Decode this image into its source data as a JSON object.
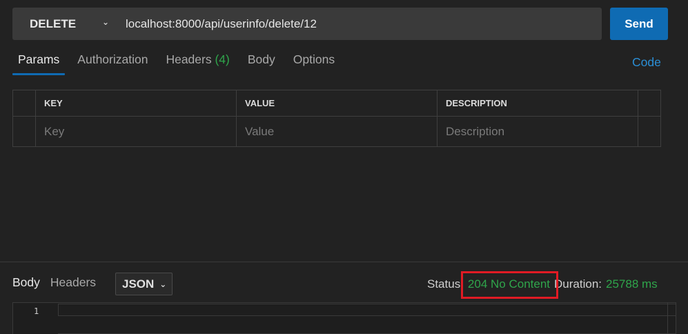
{
  "request": {
    "method": "DELETE",
    "url": "localhost:8000/api/userinfo/delete/12",
    "send_label": "Send"
  },
  "tabs": {
    "params": "Params",
    "authorization": "Authorization",
    "headers": "Headers",
    "headers_count": "(4)",
    "body": "Body",
    "options": "Options",
    "active": "Params"
  },
  "code_link": "Code",
  "params_table": {
    "columns": [
      "KEY",
      "VALUE",
      "DESCRIPTION"
    ],
    "placeholders": [
      "Key",
      "Value",
      "Description"
    ]
  },
  "response": {
    "tabs": [
      "Body",
      "Headers"
    ],
    "active_tab": "Body",
    "format": "JSON",
    "status_label": "Status:",
    "status_value": "204 No Content",
    "duration_label": "Duration:",
    "duration_value": "25788 ms"
  },
  "editor": {
    "line_number": "1"
  },
  "colors": {
    "accent": "#0f6bb3",
    "success": "#2fa54b",
    "link": "#2b8fd6",
    "highlight": "#e01b24"
  }
}
